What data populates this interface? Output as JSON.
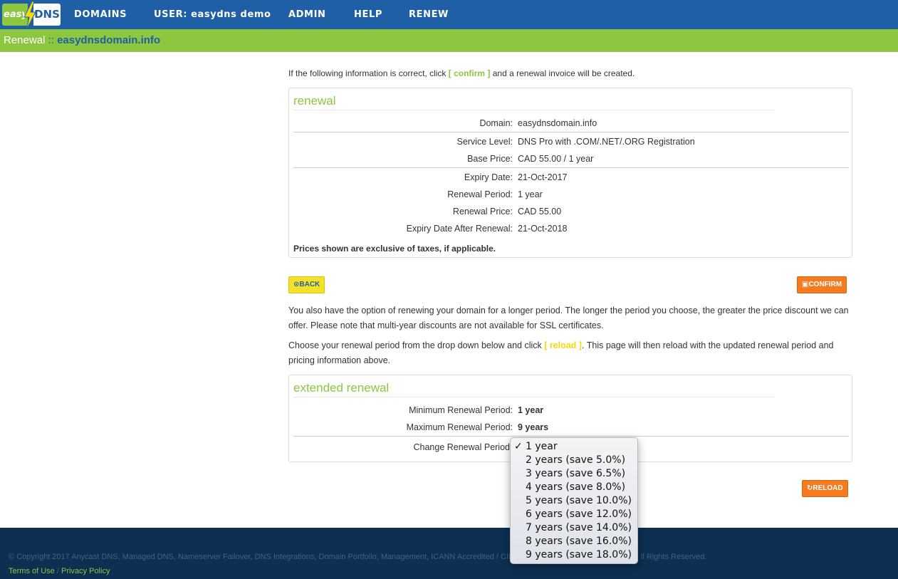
{
  "nav": {
    "logo_easy": "easy",
    "logo_dns": "DNS",
    "items": [
      "DOMAINS",
      "USER: easydns demo",
      "ADMIN",
      "HELP",
      "RENEW"
    ]
  },
  "header": {
    "section": "Renewal",
    "separator": "::",
    "domain": "easydnsdomain.info"
  },
  "intro": {
    "before": "If the following information is correct, click ",
    "link": "[ confirm ]",
    "after": " and a renewal invoice will be created."
  },
  "renewal": {
    "title": "renewal",
    "rows": [
      {
        "label": "Domain:",
        "value": "easydnsdomain.info"
      },
      {
        "label": "Service Level:",
        "value": "DNS Pro with .COM/.NET/.ORG Registration"
      },
      {
        "label": "Base Price:",
        "value": "CAD 55.00 / 1 year"
      },
      {
        "label": "Expiry Date:",
        "value": "21-Oct-2017"
      },
      {
        "label": "Renewal Period:",
        "value": "1 year"
      },
      {
        "label": "Renewal Price:",
        "value": "CAD 55.00"
      },
      {
        "label": "Expiry Date After Renewal:",
        "value": "21-Oct-2018"
      }
    ],
    "note": "Prices shown are exclusive of taxes, if applicable."
  },
  "buttons": {
    "back": "BACK",
    "confirm": "CONFIRM",
    "reload": "RELOAD"
  },
  "paragraphs": {
    "p1": "You also have the option of renewing your domain for a longer period. The longer the period you choose, the greater the price discount we can offer. Please note that multi-year discounts are not available for SSL certificates.",
    "p2_before": "Choose your renewal period from the drop down below and click ",
    "p2_link": "[ reload ]",
    "p2_after": ". This page will then reload with the updated renewal period and pricing information above."
  },
  "extended": {
    "title": "extended renewal",
    "rows": [
      {
        "label": "Minimum Renewal Period:",
        "value": "1 year"
      },
      {
        "label": "Maximum Renewal Period:",
        "value": "9 years"
      }
    ],
    "change_label": "Change Renewal Period",
    "selected": "1 year",
    "options": [
      "1 year",
      "2 years (save 5.0%)",
      "3 years (save 6.5%)",
      "4 years (save 8.0%)",
      "5 years (save 10.0%)",
      "6 years (save 12.0%)",
      "7 years (save 14.0%)",
      "8 years (save 16.0%)",
      "9 years (save 18.0%)"
    ]
  },
  "footer": {
    "copyright_left": "© Copyright 2017 Anycast DNS, Managed DNS, Nameserver Failover, DNS Integrations, Domain Portfolio, Management, ICANN Accredited / CIR",
    "copyright_right": "ll Rights Reserved.",
    "terms": "Terms of Use",
    "slash": "/",
    "privacy": "Privacy Policy"
  },
  "colors": {
    "nav_blue": "#1f5fa6",
    "brand_green": "#8dc63f",
    "button_orange": "#f47b20",
    "button_yellow": "#f5e12a",
    "footer_navy": "#0d2f52"
  }
}
